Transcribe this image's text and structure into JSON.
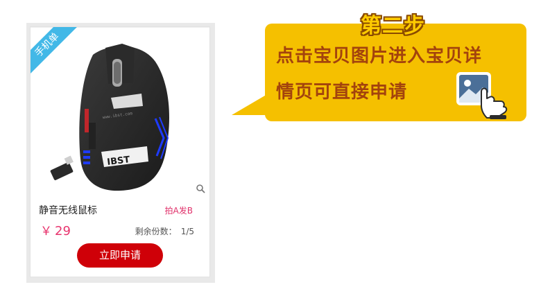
{
  "card": {
    "ribbon_label": "手机单",
    "product_title": "静音无线鼠标",
    "product_tag": "拍A发B",
    "price_symbol": "￥",
    "price_value": "29",
    "remaining_label": "剩余份数：",
    "remaining_count": "1/5",
    "apply_button": "立即申请",
    "image_alt": "IBST"
  },
  "callout": {
    "step_title": "第二步",
    "line1": "点击宝贝图片进入宝贝详",
    "line2": "情页可直接申请"
  },
  "colors": {
    "ribbon": "#42b8e7",
    "price": "#e8346e",
    "tag": "#e0306a",
    "button": "#cf0008",
    "callout_bg": "#f5c000",
    "callout_text": "#a3430d",
    "step_title_fill": "#ffcc00"
  },
  "icons": [
    "zoom-icon",
    "picture-click-icon",
    "ribbon-mobile-order"
  ]
}
